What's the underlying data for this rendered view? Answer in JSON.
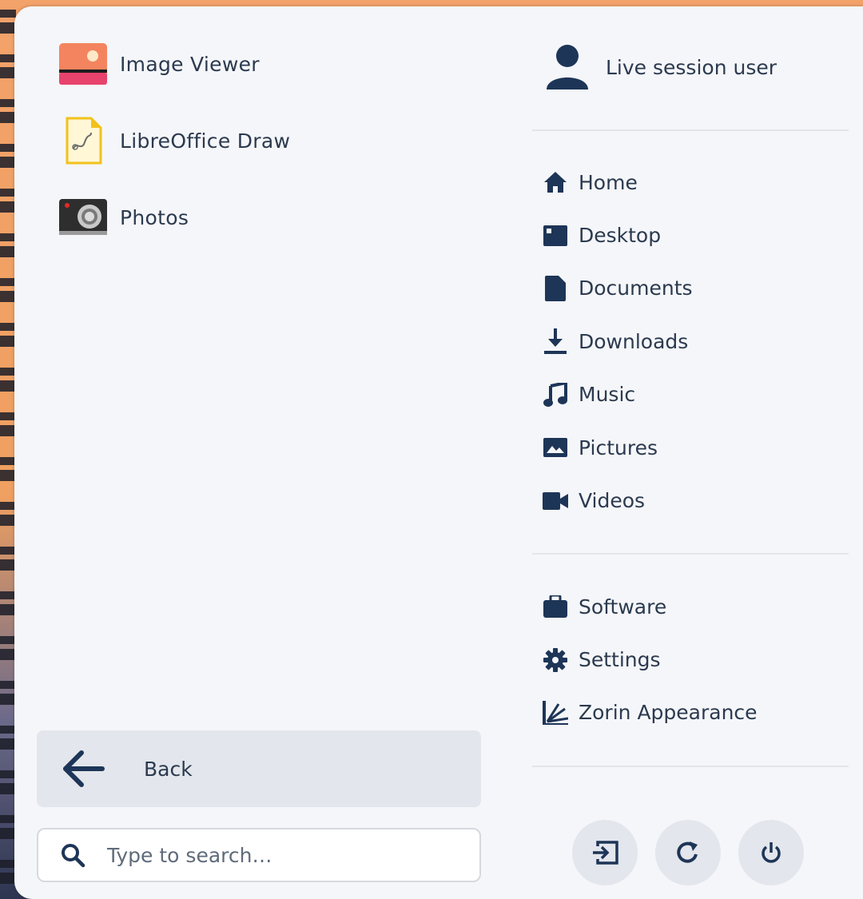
{
  "colors": {
    "accent": "#1d3557",
    "text": "#2b3a4f",
    "panel": "#f5f6f9",
    "button_bg": "#e3e6ec"
  },
  "apps": [
    {
      "label": "Image Viewer",
      "icon": "image-viewer-icon"
    },
    {
      "label": "LibreOffice Draw",
      "icon": "libreoffice-draw-icon"
    },
    {
      "label": "Photos",
      "icon": "photos-camera-icon"
    }
  ],
  "back": {
    "label": "Back",
    "icon": "arrow-left-icon"
  },
  "search": {
    "placeholder": "Type to search…",
    "value": "",
    "icon": "search-icon"
  },
  "user": {
    "name": "Live session user",
    "icon": "user-icon"
  },
  "places": [
    {
      "label": "Home",
      "icon": "home-icon"
    },
    {
      "label": "Desktop",
      "icon": "desktop-icon"
    },
    {
      "label": "Documents",
      "icon": "document-icon"
    },
    {
      "label": "Downloads",
      "icon": "download-icon"
    },
    {
      "label": "Music",
      "icon": "music-icon"
    },
    {
      "label": "Pictures",
      "icon": "pictures-icon"
    },
    {
      "label": "Videos",
      "icon": "video-icon"
    }
  ],
  "system": [
    {
      "label": "Software",
      "icon": "software-icon"
    },
    {
      "label": "Settings",
      "icon": "gear-icon"
    },
    {
      "label": "Zorin Appearance",
      "icon": "appearance-icon"
    }
  ],
  "power_buttons": [
    {
      "name": "log-out",
      "icon": "logout-icon"
    },
    {
      "name": "restart",
      "icon": "restart-icon"
    },
    {
      "name": "power-off",
      "icon": "power-icon"
    }
  ]
}
